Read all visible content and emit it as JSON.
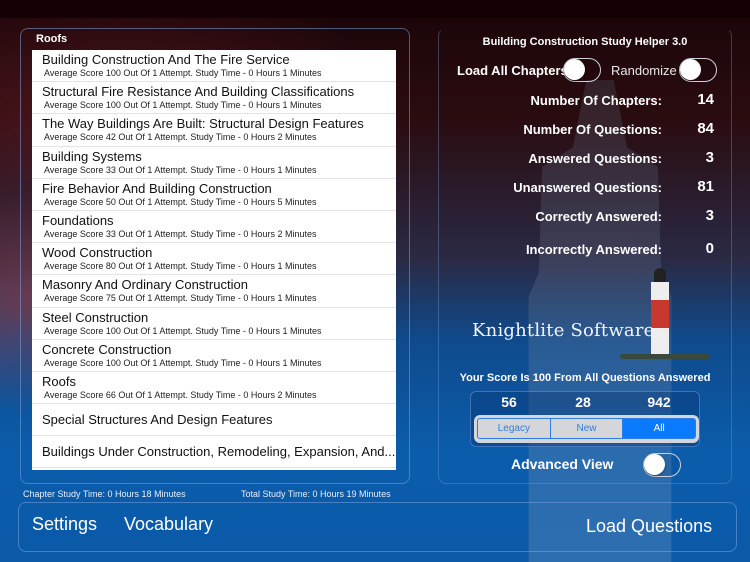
{
  "left_panel": {
    "title": "Roofs",
    "chapters": [
      {
        "title": "Building Construction And The Fire Service",
        "detail": "Average Score 100 Out Of 1 Attempt. Study Time - 0 Hours 1 Minutes"
      },
      {
        "title": "Structural Fire Resistance And Building Classifications",
        "detail": "Average Score 100 Out Of 1 Attempt. Study Time - 0 Hours 1 Minutes"
      },
      {
        "title": "The Way Buildings Are Built: Structural Design Features",
        "detail": "Average Score 42 Out Of 1 Attempt. Study Time - 0 Hours 2 Minutes"
      },
      {
        "title": "Building Systems",
        "detail": "Average Score 33 Out Of 1 Attempt. Study Time - 0 Hours 1 Minutes"
      },
      {
        "title": "Fire Behavior And Building Construction",
        "detail": "Average Score 50 Out Of 1 Attempt. Study Time - 0 Hours 5 Minutes"
      },
      {
        "title": "Foundations",
        "detail": "Average Score 33 Out Of 1 Attempt. Study Time - 0 Hours 2 Minutes"
      },
      {
        "title": "Wood Construction",
        "detail": "Average Score 80 Out Of 1 Attempt. Study Time - 0 Hours 1 Minutes"
      },
      {
        "title": "Masonry And Ordinary Construction",
        "detail": "Average Score 75 Out Of 1 Attempt. Study Time - 0 Hours 1 Minutes"
      },
      {
        "title": "Steel Construction",
        "detail": "Average Score 100 Out Of 1 Attempt. Study Time - 0 Hours 1 Minutes"
      },
      {
        "title": "Concrete Construction",
        "detail": "Average Score 100 Out Of 1 Attempt. Study Time - 0 Hours 1 Minutes"
      },
      {
        "title": "Roofs",
        "detail": "Average Score 66 Out Of 1 Attempt. Study Time - 0 Hours 2 Minutes"
      },
      {
        "title": "Special Structures And Design Features",
        "detail": ""
      },
      {
        "title": "Buildings Under Construction, Remodeling, Expansion, And...",
        "detail": ""
      }
    ],
    "chapter_study_time": "Chapter Study Time: 0 Hours 18 Minutes",
    "total_study_time": "Total Study Time: 0 Hours 19 Minutes"
  },
  "right_panel": {
    "app_title": "Building Construction Study Helper 3.0",
    "load_all_chapters_label": "Load All Chapters",
    "load_all_chapters_on": false,
    "randomize_label": "Randomize",
    "randomize_on": false,
    "stats": [
      {
        "label": "Number Of Chapters:",
        "value": "14"
      },
      {
        "label": "Number Of Questions:",
        "value": "84"
      },
      {
        "label": "Answered Questions:",
        "value": "3"
      },
      {
        "label": "Unanswered Questions:",
        "value": "81"
      },
      {
        "label": "Correctly Answered:",
        "value": "3"
      },
      {
        "label": "Incorrectly Answered:",
        "value": "0"
      }
    ],
    "brand": "Knightlite Software",
    "score_message": "Your Score Is 100 From All Questions Answered",
    "counts": [
      "56",
      "28",
      "942"
    ],
    "segments": [
      "Legacy",
      "New",
      "All"
    ],
    "selected_segment": "All",
    "advanced_view_label": "Advanced View",
    "advanced_view_on": false
  },
  "bottom_bar": {
    "settings": "Settings",
    "vocabulary": "Vocabulary",
    "load_questions": "Load Questions"
  },
  "colors": {
    "accent": "#0a7aff",
    "segment_border": "#2f7de1"
  }
}
